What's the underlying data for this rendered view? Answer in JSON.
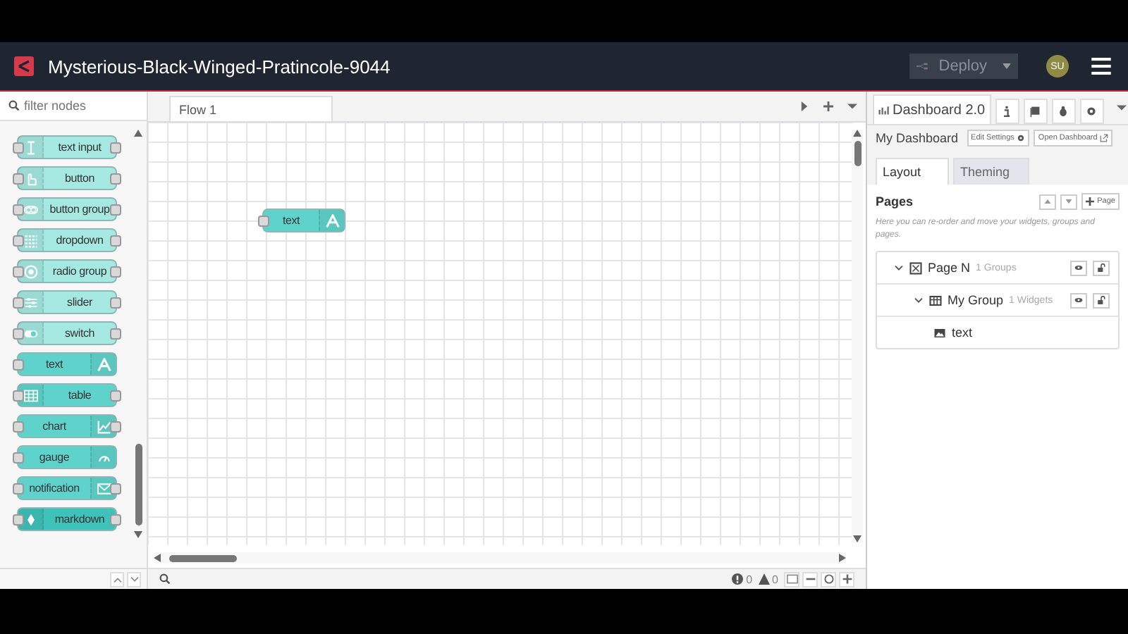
{
  "header": {
    "title": "Mysterious-Black-Winged-Pratincole-9044",
    "deploy": "Deploy",
    "avatar": "SU"
  },
  "palette": {
    "filter_placeholder": "filter nodes",
    "nodes": [
      {
        "label": "text input",
        "kind": "cursor",
        "color": "#a6e8e2",
        "input": true,
        "output": true,
        "icon_right": false
      },
      {
        "label": "button",
        "kind": "hand",
        "color": "#a6e8e2",
        "input": true,
        "output": true,
        "icon_right": false
      },
      {
        "label": "button group",
        "kind": "toggle",
        "color": "#a6e8e2",
        "input": true,
        "output": true,
        "icon_right": false
      },
      {
        "label": "dropdown",
        "kind": "list",
        "color": "#a6e8e2",
        "input": true,
        "output": true,
        "icon_right": false
      },
      {
        "label": "radio group",
        "kind": "radio",
        "color": "#a6e8e2",
        "input": true,
        "output": true,
        "icon_right": false
      },
      {
        "label": "slider",
        "kind": "sliders",
        "color": "#a6e8e2",
        "input": true,
        "output": true,
        "icon_right": false
      },
      {
        "label": "switch",
        "kind": "switch",
        "color": "#a6e8e2",
        "input": true,
        "output": true,
        "icon_right": false
      },
      {
        "label": "text",
        "kind": "font",
        "color": "#5fd3cb",
        "input": true,
        "output": false,
        "icon_right": true
      },
      {
        "label": "table",
        "kind": "table",
        "color": "#5fd3cb",
        "input": true,
        "output": true,
        "icon_right": false
      },
      {
        "label": "chart",
        "kind": "chart",
        "color": "#5fd3cb",
        "input": true,
        "output": true,
        "icon_right": true
      },
      {
        "label": "gauge",
        "kind": "gauge",
        "color": "#5fd3cb",
        "input": true,
        "output": false,
        "icon_right": true
      },
      {
        "label": "notification",
        "kind": "mail",
        "color": "#5fd3cb",
        "input": true,
        "output": true,
        "icon_right": true
      },
      {
        "label": "markdown",
        "kind": "markdown",
        "color": "#3fc2b9",
        "input": true,
        "output": true,
        "icon_right": false
      }
    ]
  },
  "workspace": {
    "tabs": [
      {
        "label": "Flow 1",
        "selected": true
      }
    ],
    "nodes": [
      {
        "label": "text",
        "kind": "font",
        "input": true,
        "output": false
      }
    ],
    "warnings": {
      "errors": "0",
      "warnings": "0"
    }
  },
  "sidebar": {
    "tab": "Dashboard 2.0",
    "dashboard": "My Dashboard",
    "edit_settings": "Edit Settings",
    "open_dashboard": "Open Dashboard",
    "subtabs": [
      {
        "label": "Layout",
        "selected": true
      },
      {
        "label": "Theming",
        "selected": false
      }
    ],
    "pages_title": "Pages",
    "add_page": "Page",
    "hint": "Here you can re-order and move your widgets, groups and pages.",
    "tree": [
      {
        "kind": "page",
        "label": "Page N",
        "count": "1 Groups",
        "expanded": true,
        "children": [
          {
            "kind": "group",
            "label": "My Group",
            "count": "1 Widgets",
            "expanded": true,
            "children": [
              {
                "kind": "widget",
                "label": "text"
              }
            ]
          }
        ]
      }
    ]
  }
}
